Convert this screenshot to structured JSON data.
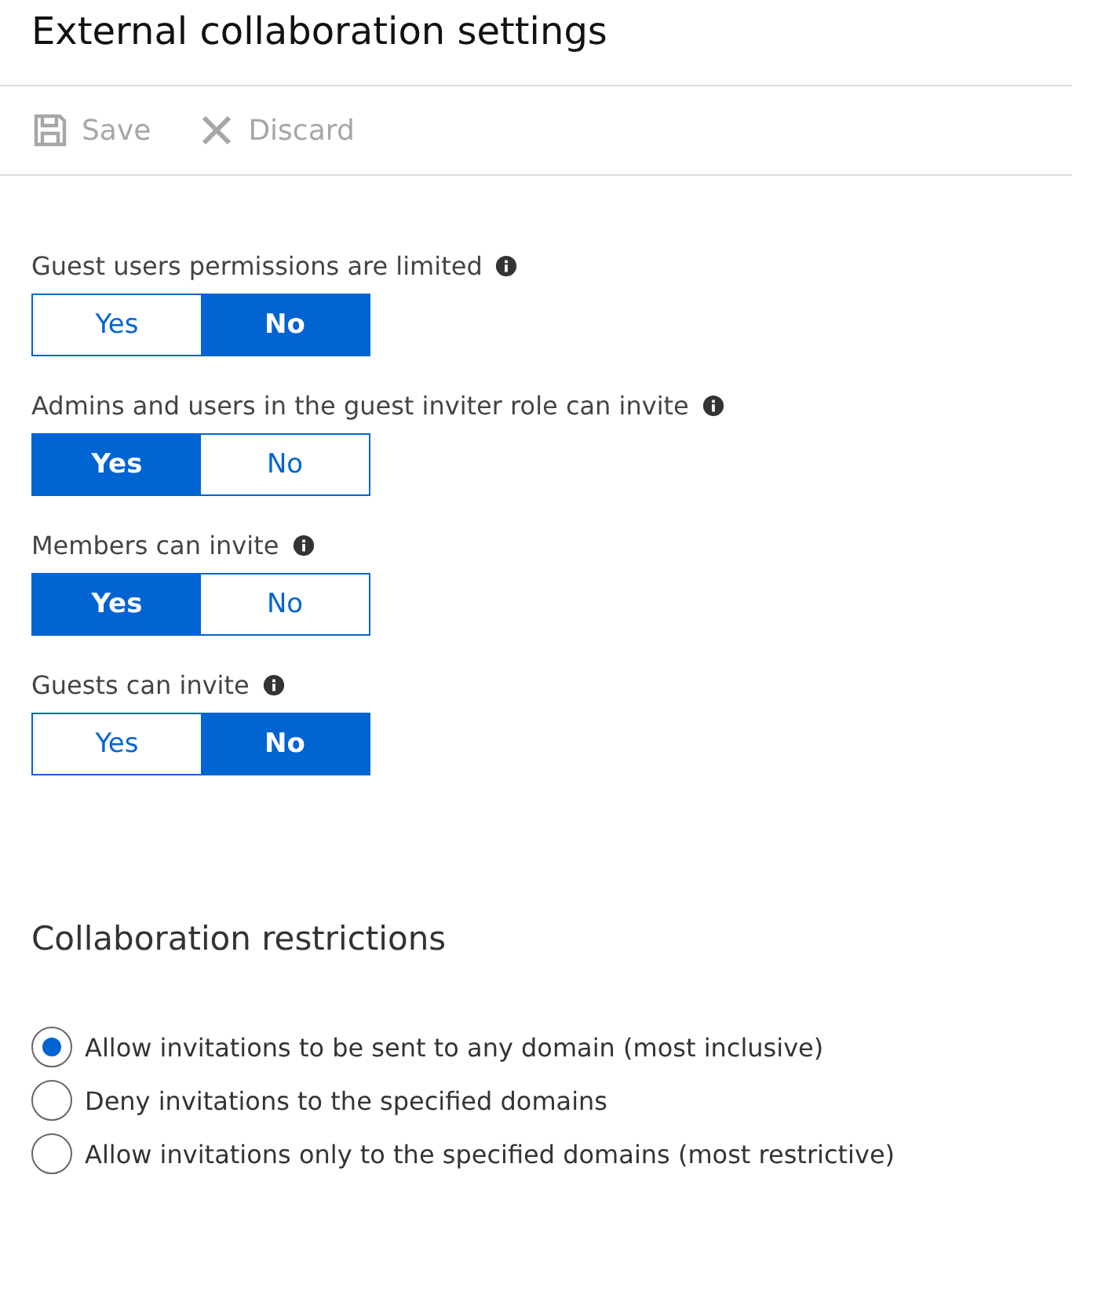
{
  "title": "External collaboration settings",
  "toolbar": [
    {
      "label": "Save",
      "kind": "save",
      "disabled": true
    },
    {
      "label": "Discard",
      "kind": "discard",
      "disabled": true
    }
  ],
  "settings": [
    {
      "label": "Guest users permissions are limited",
      "options": [
        {
          "label": "Yes",
          "selected": false
        },
        {
          "label": "No",
          "selected": true
        }
      ]
    },
    {
      "label": "Admins and users in the guest inviter role can invite",
      "options": [
        {
          "label": "Yes",
          "selected": true
        },
        {
          "label": "No",
          "selected": false
        }
      ]
    },
    {
      "label": "Members can invite",
      "options": [
        {
          "label": "Yes",
          "selected": true
        },
        {
          "label": "No",
          "selected": false
        }
      ]
    },
    {
      "label": "Guests can invite",
      "options": [
        {
          "label": "Yes",
          "selected": false
        },
        {
          "label": "No",
          "selected": true
        }
      ]
    }
  ],
  "restrictions": {
    "title": "Collaboration restrictions",
    "options": [
      {
        "label": "Allow invitations to be sent to any domain (most inclusive)",
        "selected": true
      },
      {
        "label": "Deny invitations to the specified domains",
        "selected": false
      },
      {
        "label": "Allow invitations only to the specified domains (most restrictive)",
        "selected": false
      }
    ]
  }
}
